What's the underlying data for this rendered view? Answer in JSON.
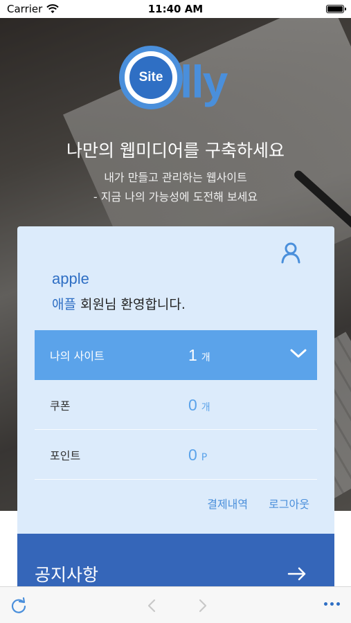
{
  "status_bar": {
    "carrier": "Carrier",
    "time": "11:40 AM"
  },
  "hero": {
    "logo_badge": "Site",
    "logo_text": "lly",
    "headline": "나만의 웹미디어를 구축하세요",
    "subline1": "내가 만들고 관리하는 웹사이트",
    "subline2": "- 지금 나의 가능성에 도전해 보세요"
  },
  "account": {
    "username": "apple",
    "display_name": "애플",
    "welcome_suffix": " 회원님 환영합니다.",
    "rows": [
      {
        "label": "나의 사이트",
        "value": "1",
        "unit": "개"
      },
      {
        "label": "쿠폰",
        "value": "0",
        "unit": "개"
      },
      {
        "label": "포인트",
        "value": "0",
        "unit": "P"
      }
    ],
    "payment_history": "결제내역",
    "logout": "로그아웃"
  },
  "notice": {
    "title": "공지사항"
  },
  "colors": {
    "brand_blue": "#2f6fc4",
    "light_blue": "#5ba3ea",
    "card_bg": "#dcebfb",
    "notice_bg": "#3566b9"
  },
  "icons": {
    "user": "user-icon",
    "chevron": "chevron-down-icon",
    "arrow": "arrow-right-icon",
    "refresh": "refresh-icon",
    "back": "back-icon",
    "forward": "forward-icon",
    "more": "more-icon"
  }
}
